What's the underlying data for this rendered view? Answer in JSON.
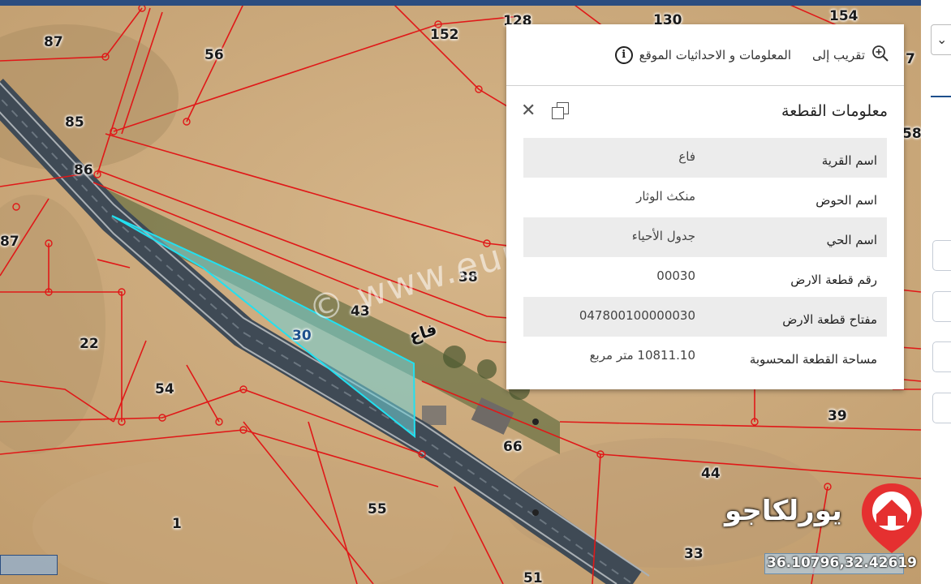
{
  "map": {
    "parcel_labels": [
      {
        "id": "87-top",
        "text": "87"
      },
      {
        "id": "56",
        "text": "56"
      },
      {
        "id": "152",
        "text": "152"
      },
      {
        "id": "128",
        "text": "128"
      },
      {
        "id": "130",
        "text": "130"
      },
      {
        "id": "154",
        "text": "154"
      },
      {
        "id": "85",
        "text": "85"
      },
      {
        "id": "86",
        "text": "86"
      },
      {
        "id": "87-left",
        "text": "87"
      },
      {
        "id": "38",
        "text": "38"
      },
      {
        "id": "43",
        "text": "43"
      },
      {
        "id": "30",
        "text": "30"
      },
      {
        "id": "22",
        "text": "22"
      },
      {
        "id": "54",
        "text": "54"
      },
      {
        "id": "66",
        "text": "66"
      },
      {
        "id": "39",
        "text": "39"
      },
      {
        "id": "44",
        "text": "44"
      },
      {
        "id": "55",
        "text": "55"
      },
      {
        "id": "1",
        "text": "1"
      },
      {
        "id": "33",
        "text": "33"
      },
      {
        "id": "51",
        "text": "51"
      },
      {
        "id": "7-edge",
        "text": "7"
      },
      {
        "id": "58-edge",
        "text": "58"
      }
    ],
    "village_label": "فاع",
    "watermark": "© www.eur kajo.com",
    "selected_parcel": "30",
    "colors": {
      "parcel_lines": "#e01818",
      "selected_fill": "#6fd0d6",
      "selected_stroke": "#22e0f0",
      "road": "#3f4a55"
    }
  },
  "popup": {
    "actions": {
      "zoom_label": "تقريب إلى",
      "info_label": "المعلومات و الاحداثيات الموقع"
    },
    "title": "معلومات القطعة",
    "rows": [
      {
        "key": "اسم القرية",
        "value": "فاع"
      },
      {
        "key": "اسم الحوض",
        "value": "منكث الوثار"
      },
      {
        "key": "اسم الحي",
        "value": "جدول الأحياء"
      },
      {
        "key": "رقم قطعة الارض",
        "value": "00030"
      },
      {
        "key": "مفتاح قطعة الارض",
        "value": "047800100000030"
      },
      {
        "key": "مساحة القطعة المحسوبة",
        "value": "10811.10 متر مربع"
      }
    ]
  },
  "coordinates": "36.10796,32.42619",
  "logo": {
    "text": "يورلكاجو"
  },
  "icons": {
    "zoom": "zoom-in-icon",
    "info": "info-icon",
    "close": "close-icon",
    "restore": "restore-window-icon",
    "dropdown": "chevron-down-icon"
  }
}
